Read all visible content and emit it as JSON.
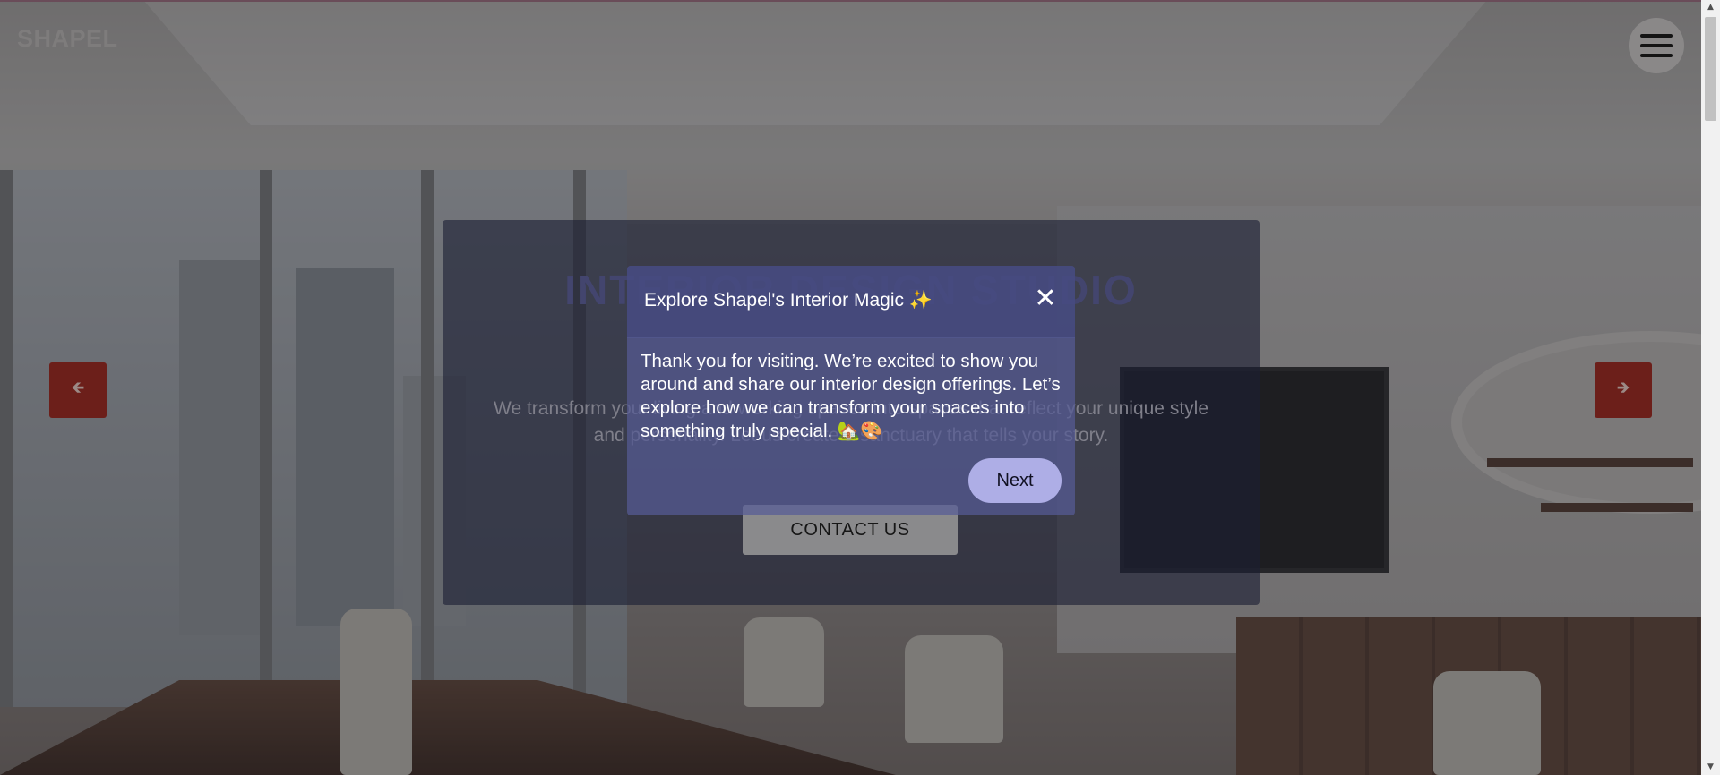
{
  "header": {
    "logo": "SHAPEL",
    "menu_icon": "hamburger-menu-icon"
  },
  "hero": {
    "title": "INTERIOR DESIGN STUDIO",
    "description": "We transform your living and working spaces into spaces that reflect your unique style and personality. Let us create a sanctuary that tells your story.",
    "contact_label": "CONTACT US",
    "prev_icon": "arrow-left-icon",
    "next_icon": "arrow-right-icon"
  },
  "modal": {
    "title": "Explore Shapel's Interior Magic ✨",
    "close_label": "✕",
    "body": "Thank you for visiting. We’re excited to show you around and share our interior design offerings. Let’s explore how we can transform your spaces into something truly special. 🏡🎨",
    "next_label": "Next"
  },
  "colors": {
    "modal_accent": "#aeaee6",
    "arrow_button": "#6c1f1a",
    "overlay": "#1c1e34"
  }
}
